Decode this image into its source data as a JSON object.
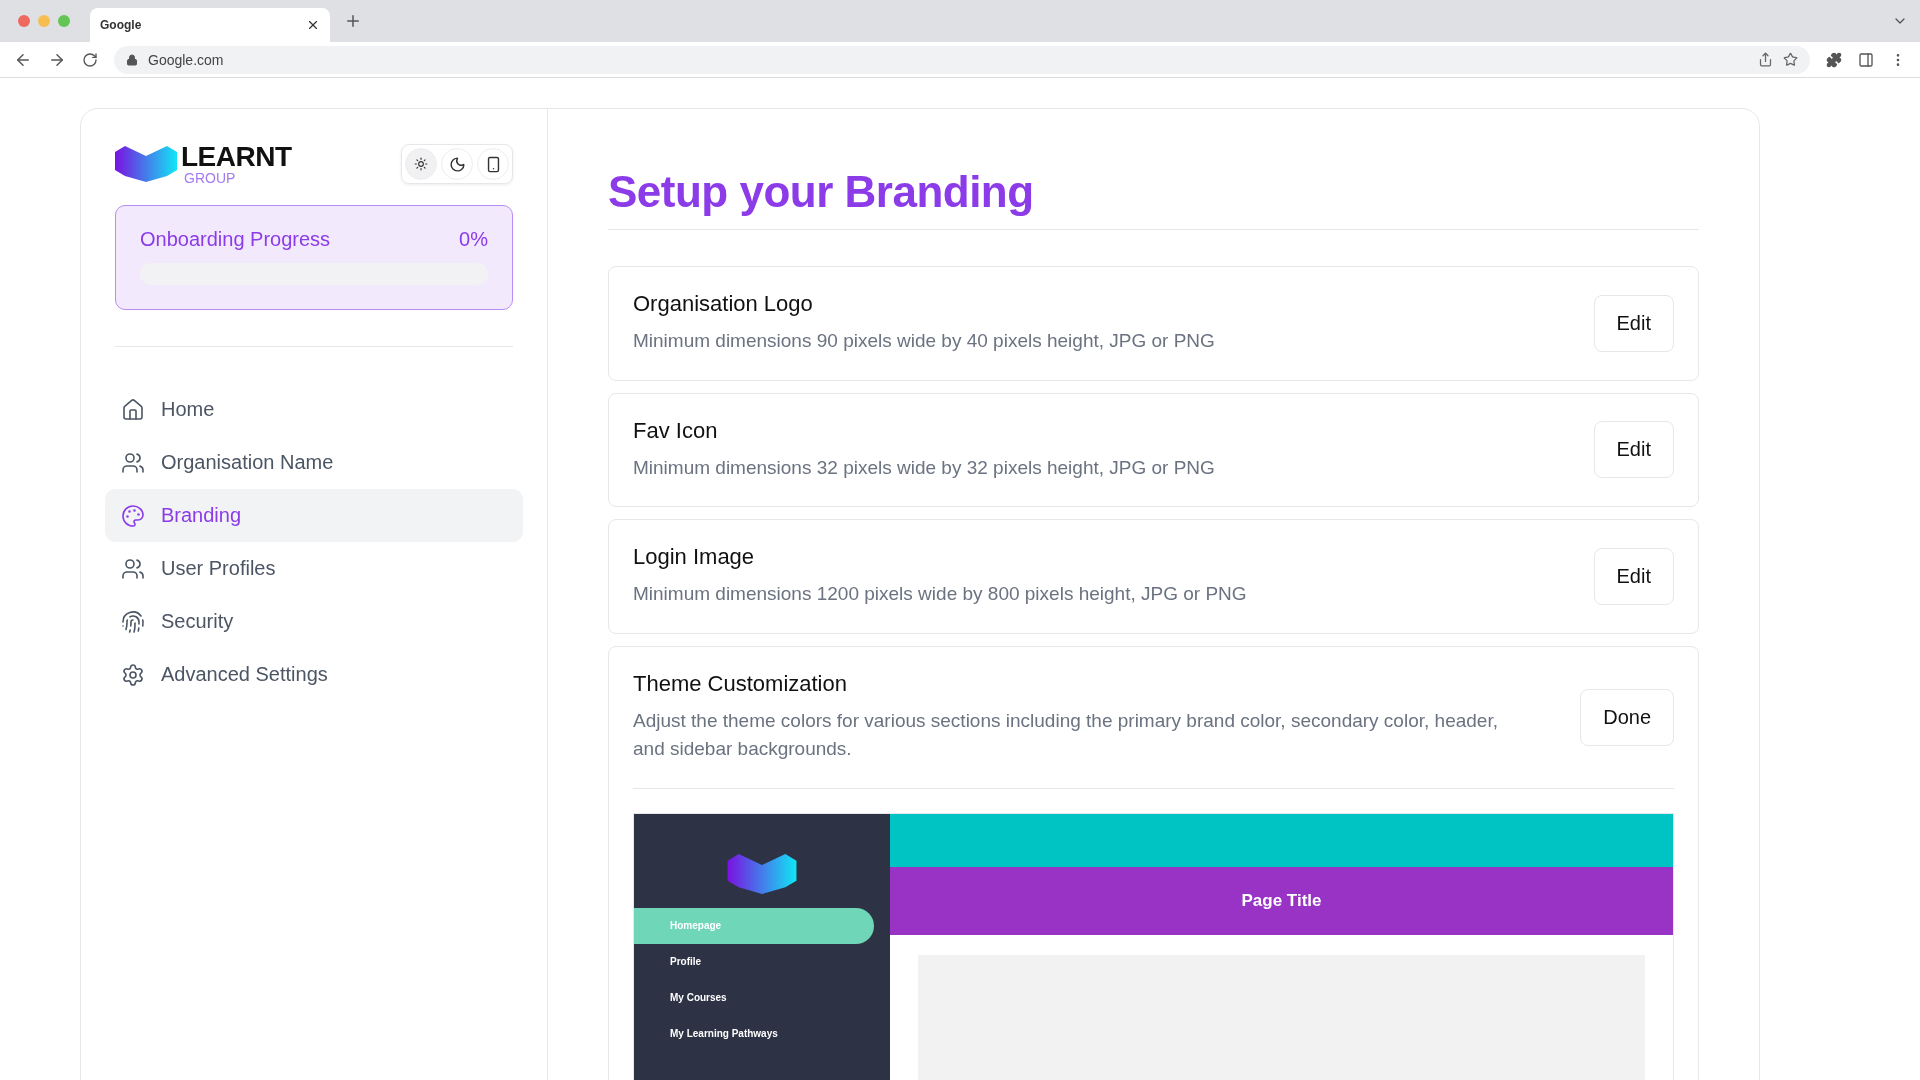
{
  "browser": {
    "tab_title": "Google",
    "address": "Google.com"
  },
  "logo": {
    "name": "LEARNT",
    "subtitle": "GROUP"
  },
  "theme_toggle": [
    {
      "kind": "light",
      "selected": true
    },
    {
      "kind": "dark",
      "selected": false
    },
    {
      "kind": "device",
      "selected": false
    }
  ],
  "progress": {
    "label": "Onboarding Progress",
    "reading": "0%",
    "level": 0
  },
  "sidebar": {
    "items": [
      {
        "label": "Home",
        "selected": false
      },
      {
        "label": "Organisation Name",
        "selected": false
      },
      {
        "label": "Branding",
        "selected": true
      },
      {
        "label": "User Profiles",
        "selected": false
      },
      {
        "label": "Security",
        "selected": false
      },
      {
        "label": "Advanced Settings",
        "selected": false
      }
    ]
  },
  "page_title": "Setup your Branding",
  "sections": [
    {
      "title": "Organisation Logo",
      "description": "Minimum dimensions 90 pixels wide by 40 pixels height, JPG or PNG",
      "button": "Edit"
    },
    {
      "title": "Fav Icon",
      "description": "Minimum dimensions 32 pixels wide by 32 pixels height, JPG or PNG",
      "button": "Edit"
    },
    {
      "title": "Login Image",
      "description": "Minimum dimensions 1200 pixels wide by 800 pixels height, JPG or PNG",
      "button": "Edit"
    },
    {
      "title": "Theme Customization",
      "description": "Adjust the theme colors for various sections including the primary brand color, secondary color, header, and sidebar backgrounds.",
      "button": "Done"
    }
  ],
  "preview": {
    "page_title": "Page Title",
    "nav": [
      {
        "label": "Homepage",
        "selected": true
      },
      {
        "label": "Profile",
        "selected": false
      },
      {
        "label": "My Courses",
        "selected": false
      },
      {
        "label": "My Learning Pathways",
        "selected": false
      }
    ]
  }
}
